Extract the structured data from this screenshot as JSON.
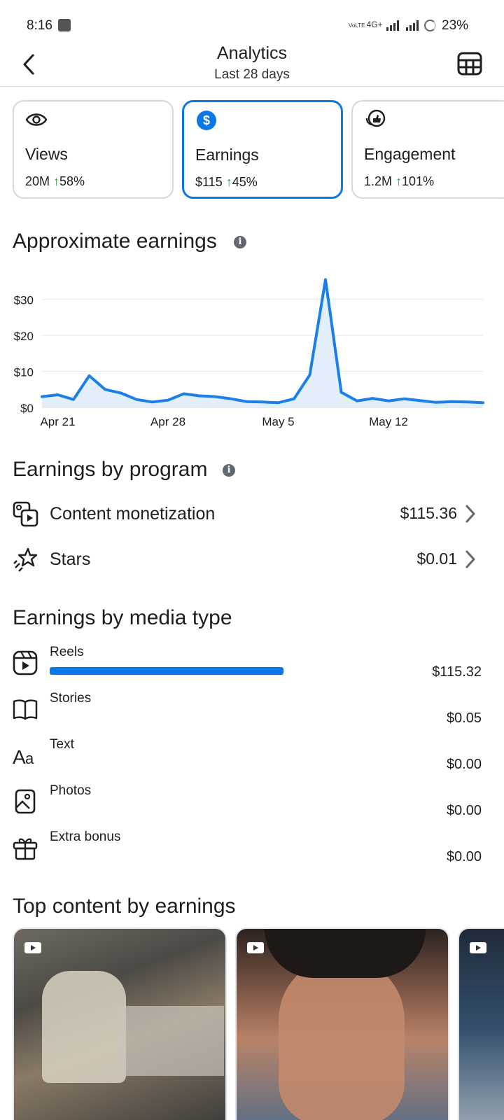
{
  "status_bar": {
    "time": "8:16",
    "network": "4G+",
    "battery": "23%"
  },
  "header": {
    "title": "Analytics",
    "subtitle": "Last 28 days",
    "back_icon": "chevron-left-icon",
    "table_icon": "table-icon"
  },
  "metric_cards": [
    {
      "label": "Views",
      "value": "20M",
      "change": "58%",
      "icon": "eye-icon",
      "selected": false
    },
    {
      "label": "Earnings",
      "value": "$115",
      "change": "45%",
      "icon": "dollar-circle-icon",
      "selected": true
    },
    {
      "label": "Engagement",
      "value": "1.2M",
      "change": "101%",
      "icon": "thumbs-up-icon",
      "selected": false
    }
  ],
  "sections": {
    "approx_earnings": "Approximate earnings",
    "by_program": "Earnings by program",
    "by_media": "Earnings by media type",
    "top_content": "Top content by earnings"
  },
  "chart_data": {
    "type": "area",
    "title": "",
    "xlabel": "",
    "ylabel": "",
    "x_tick_labels": [
      "Apr 21",
      "Apr 28",
      "May 5",
      "May 12"
    ],
    "y_tick_labels": [
      "$0",
      "$10",
      "$20",
      "$30"
    ],
    "ylim": [
      0,
      35
    ],
    "grid": true,
    "color": "#1a7fe8",
    "x": [
      "Apr 20",
      "Apr 21",
      "Apr 22",
      "Apr 23",
      "Apr 24",
      "Apr 25",
      "Apr 26",
      "Apr 27",
      "Apr 28",
      "Apr 29",
      "Apr 30",
      "May 1",
      "May 2",
      "May 3",
      "May 4",
      "May 5",
      "May 6",
      "May 7",
      "May 8",
      "May 9",
      "May 10",
      "May 11",
      "May 12",
      "May 13",
      "May 14",
      "May 15",
      "May 16",
      "May 17",
      "May 18"
    ],
    "values": [
      3.0,
      3.5,
      2.2,
      8.8,
      5.0,
      4.0,
      2.2,
      1.5,
      2.0,
      3.8,
      3.2,
      3.0,
      2.4,
      1.6,
      1.5,
      1.3,
      2.4,
      9.0,
      35.5,
      4.2,
      1.8,
      2.5,
      1.8,
      2.4,
      1.9,
      1.4,
      1.6,
      1.5,
      1.3
    ]
  },
  "programs": [
    {
      "label": "Content monetization",
      "value": "$115.36",
      "icon": "content-monetization-icon"
    },
    {
      "label": "Stars",
      "value": "$0.01",
      "icon": "stars-icon"
    }
  ],
  "media_types": [
    {
      "label": "Reels",
      "value": "$115.32",
      "share": 0.53,
      "icon": "reels-icon"
    },
    {
      "label": "Stories",
      "value": "$0.05",
      "share": 0,
      "icon": "book-icon"
    },
    {
      "label": "Text",
      "value": "$0.00",
      "share": 0,
      "icon": "text-icon"
    },
    {
      "label": "Photos",
      "value": "$0.00",
      "share": 0,
      "icon": "photo-icon"
    },
    {
      "label": "Extra bonus",
      "value": "$0.00",
      "share": 0,
      "icon": "gift-icon"
    }
  ]
}
